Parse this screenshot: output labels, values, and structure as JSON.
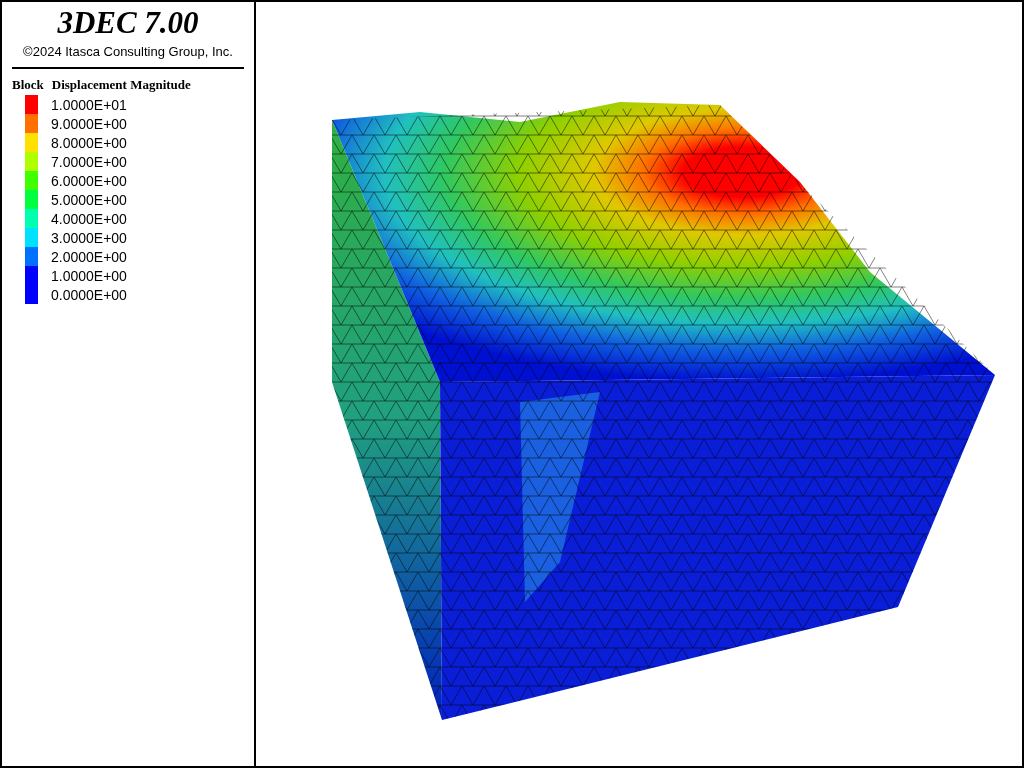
{
  "title": "3DEC 7.00",
  "copyright": "©2024 Itasca Consulting Group, Inc.",
  "legend": {
    "title_part_1": "Block",
    "title_part_2": "Displacement Magnitude",
    "items": [
      {
        "label": "1.0000E+01",
        "color": "#ff0000"
      },
      {
        "label": "9.0000E+00",
        "color": "#ff7000"
      },
      {
        "label": "8.0000E+00",
        "color": "#ffe000"
      },
      {
        "label": "7.0000E+00",
        "color": "#b0ff00"
      },
      {
        "label": "6.0000E+00",
        "color": "#40ff00"
      },
      {
        "label": "5.0000E+00",
        "color": "#00ff40"
      },
      {
        "label": "4.0000E+00",
        "color": "#00ffb0"
      },
      {
        "label": "3.0000E+00",
        "color": "#00e0ff"
      },
      {
        "label": "2.0000E+00",
        "color": "#0070ff"
      },
      {
        "label": "1.0000E+00",
        "color": "#0000ff"
      },
      {
        "label": "0.0000E+00",
        "color": "#0000ff"
      }
    ]
  }
}
